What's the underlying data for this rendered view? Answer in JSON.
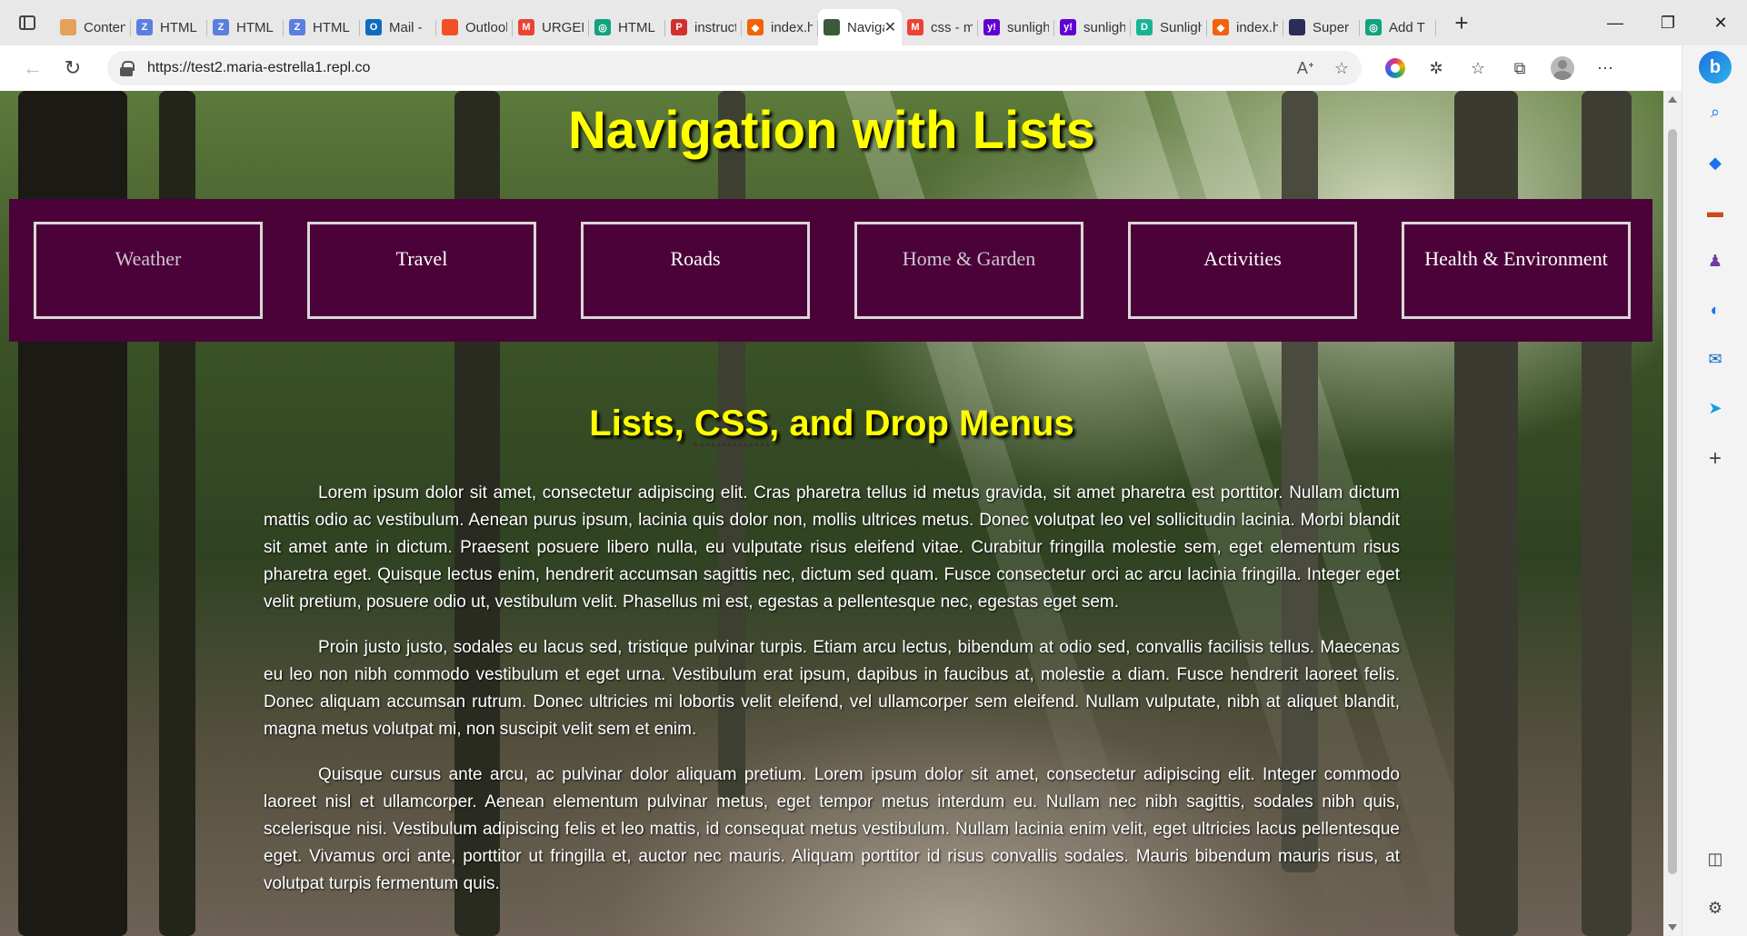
{
  "browser": {
    "tabs": [
      {
        "title": "Content",
        "favicon_color": "#e3a15a",
        "favicon_glyph": ""
      },
      {
        "title": "HTML",
        "favicon_color": "#5b7fe0",
        "favicon_glyph": "Z"
      },
      {
        "title": "HTML",
        "favicon_color": "#5b7fe0",
        "favicon_glyph": "Z"
      },
      {
        "title": "HTML",
        "favicon_color": "#5b7fe0",
        "favicon_glyph": "Z"
      },
      {
        "title": "Mail -",
        "favicon_color": "#0f6cbd",
        "favicon_glyph": "O"
      },
      {
        "title": "Outlook",
        "favicon_color": "#f25022",
        "favicon_glyph": ""
      },
      {
        "title": "URGENT",
        "favicon_color": "#ea4335",
        "favicon_glyph": "M"
      },
      {
        "title": "HTML",
        "favicon_color": "#10a37f",
        "favicon_glyph": "◎"
      },
      {
        "title": "instructions",
        "favicon_color": "#d32f2f",
        "favicon_glyph": "P"
      },
      {
        "title": "index.h",
        "favicon_color": "#f26207",
        "favicon_glyph": "◆"
      },
      {
        "title": "Navigation with Lists",
        "favicon_color": "#3a5a3a",
        "favicon_glyph": "",
        "active": true
      },
      {
        "title": "css - m",
        "favicon_color": "#ea4335",
        "favicon_glyph": "M"
      },
      {
        "title": "sunlight",
        "favicon_color": "#6001d2",
        "favicon_glyph": "y!"
      },
      {
        "title": "sunlight",
        "favicon_color": "#6001d2",
        "favicon_glyph": "y!"
      },
      {
        "title": "Sunlight",
        "favicon_color": "#19b394",
        "favicon_glyph": "D"
      },
      {
        "title": "index.h",
        "favicon_color": "#f26207",
        "favicon_glyph": "◆"
      },
      {
        "title": "Super",
        "favicon_color": "#2c2c54",
        "favicon_glyph": ""
      },
      {
        "title": "Add T",
        "favicon_color": "#10a37f",
        "favicon_glyph": "◎"
      }
    ],
    "tab_close_glyph": "✕",
    "new_tab_glyph": "+",
    "url": "https://test2.maria-estrella1.repl.co",
    "window_controls": {
      "minimize": "—",
      "maximize": "❐",
      "close": "✕"
    }
  },
  "page": {
    "title": "Navigation with Lists",
    "menu": [
      {
        "label": "Weather",
        "dim": true
      },
      {
        "label": "Travel",
        "dim": false
      },
      {
        "label": "Roads",
        "dim": false
      },
      {
        "label": "Home & Garden",
        "dim": true
      },
      {
        "label": "Activities",
        "dim": false
      },
      {
        "label": "Health & Environment",
        "dim": false
      }
    ],
    "section_title_prefix": "Lists, ",
    "section_title_abbr": "CSS",
    "section_title_suffix": ", and Drop Menus",
    "paragraphs": [
      "Lorem ipsum dolor sit amet, consectetur adipiscing elit. Cras pharetra tellus id metus gravida, sit amet pharetra est porttitor. Nullam dictum mattis odio ac vestibulum. Aenean purus ipsum, lacinia quis dolor non, mollis ultrices metus. Donec volutpat leo vel sollicitudin lacinia. Morbi blandit sit amet ante in dictum. Praesent posuere libero nulla, eu vulputate risus eleifend vitae. Curabitur fringilla molestie sem, eget elementum risus pharetra eget. Quisque lectus enim, hendrerit accumsan sagittis nec, dictum sed quam. Fusce consectetur orci ac arcu lacinia fringilla. Integer eget velit pretium, posuere odio ut, vestibulum velit. Phasellus mi est, egestas a pellentesque nec, egestas eget sem.",
      "Proin justo justo, sodales eu lacus sed, tristique pulvinar turpis. Etiam arcu lectus, bibendum at odio sed, convallis facilisis tellus. Maecenas eu leo non nibh commodo vestibulum et eget urna. Vestibulum erat ipsum, dapibus in faucibus at, molestie a diam. Fusce hendrerit laoreet felis. Donec aliquam accumsan rutrum. Donec ultricies mi lobortis velit eleifend, vel ullamcorper sem eleifend. Nullam vulputate, nibh at aliquet blandit, magna metus volutpat mi, non suscipit velit sem et enim.",
      "Quisque cursus ante arcu, ac pulvinar dolor aliquam pretium. Lorem ipsum dolor sit amet, consectetur adipiscing elit. Integer commodo laoreet nisl et ullamcorper. Aenean elementum pulvinar metus, eget tempor metus interdum eu. Nullam nec nibh sagittis, sodales nibh quis, scelerisque nisi. Vestibulum adipiscing felis et leo mattis, id consequat metus vestibulum. Nullam lacinia enim velit, eget ultricies lacus pellentesque eget. Vivamus orci ante, porttitor ut fringilla et, auctor nec mauris. Aliquam porttitor id risus convallis sodales. Mauris bibendum mauris risus, at volutpat turpis fermentum quis."
    ],
    "colors": {
      "menu_background": "#4b0239",
      "title_color": "#ffff00",
      "menu_border": "#d8d8d8"
    }
  },
  "sidebar_icons": [
    "search-icon",
    "tag-icon",
    "toolbox-icon",
    "chess-icon",
    "office-icon",
    "outlook-icon",
    "send-icon",
    "add-icon",
    "split-screen-icon",
    "settings-icon"
  ]
}
